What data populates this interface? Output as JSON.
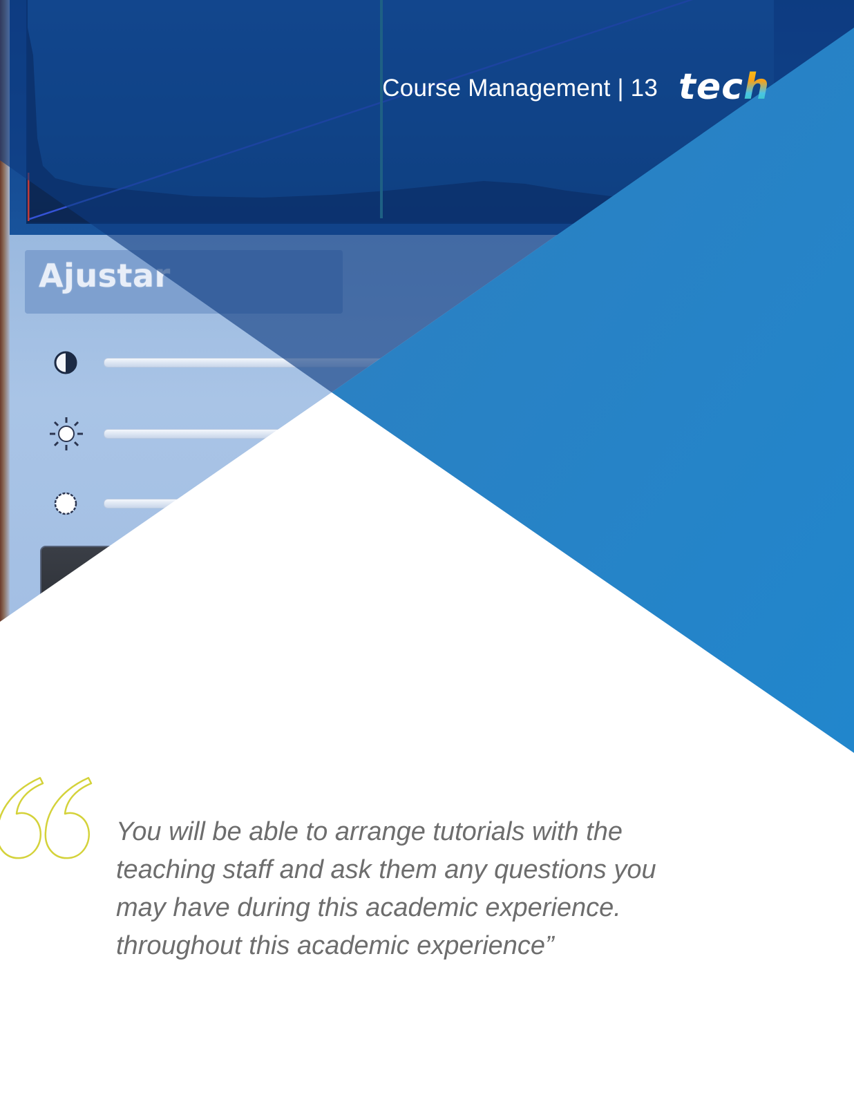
{
  "header": {
    "title": "Course Management | 13",
    "logo_main": "tec",
    "logo_accent": "h"
  },
  "photo": {
    "panel_label": "Ajustar",
    "icons": [
      "contrast-icon",
      "brightness-icon",
      "shadow-icon"
    ]
  },
  "quote": {
    "lines": [
      "You will be able to arrange tutorials with the",
      "teaching staff and ask them any questions you",
      "may have during this academic experience.",
      "throughout this academic experience”"
    ]
  },
  "colors": {
    "overlay_blue": "#2a86c9",
    "overlay_dark_blue": "#0d3a80",
    "quote_mark": "#d4d23a",
    "quote_text": "#6d6d6d"
  }
}
